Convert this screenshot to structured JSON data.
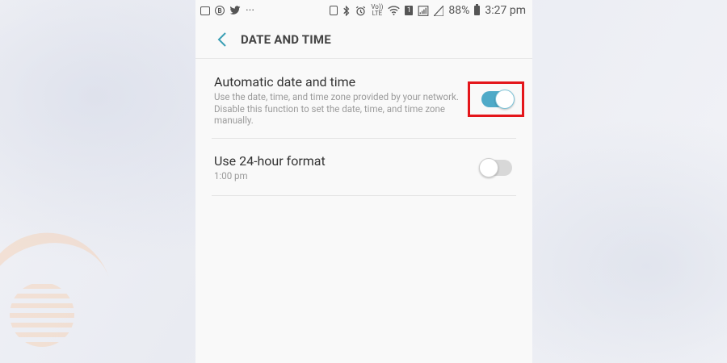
{
  "status_bar": {
    "battery": "88%",
    "time": "3:27 pm",
    "more": "···",
    "volte_top": "Vo))",
    "volte_bottom": "LTE",
    "sim_slot": "1"
  },
  "header": {
    "title": "DATE AND TIME"
  },
  "settings": [
    {
      "title": "Automatic date and time",
      "subtitle": "Use the date, time, and time zone provided by your network. Disable this function to set the date, time, and time zone manually.",
      "enabled": true
    },
    {
      "title": "Use 24-hour format",
      "subtitle": "1:00 pm",
      "enabled": false
    }
  ],
  "colors": {
    "accent": "#4faac8",
    "highlight": "#e4161b"
  }
}
